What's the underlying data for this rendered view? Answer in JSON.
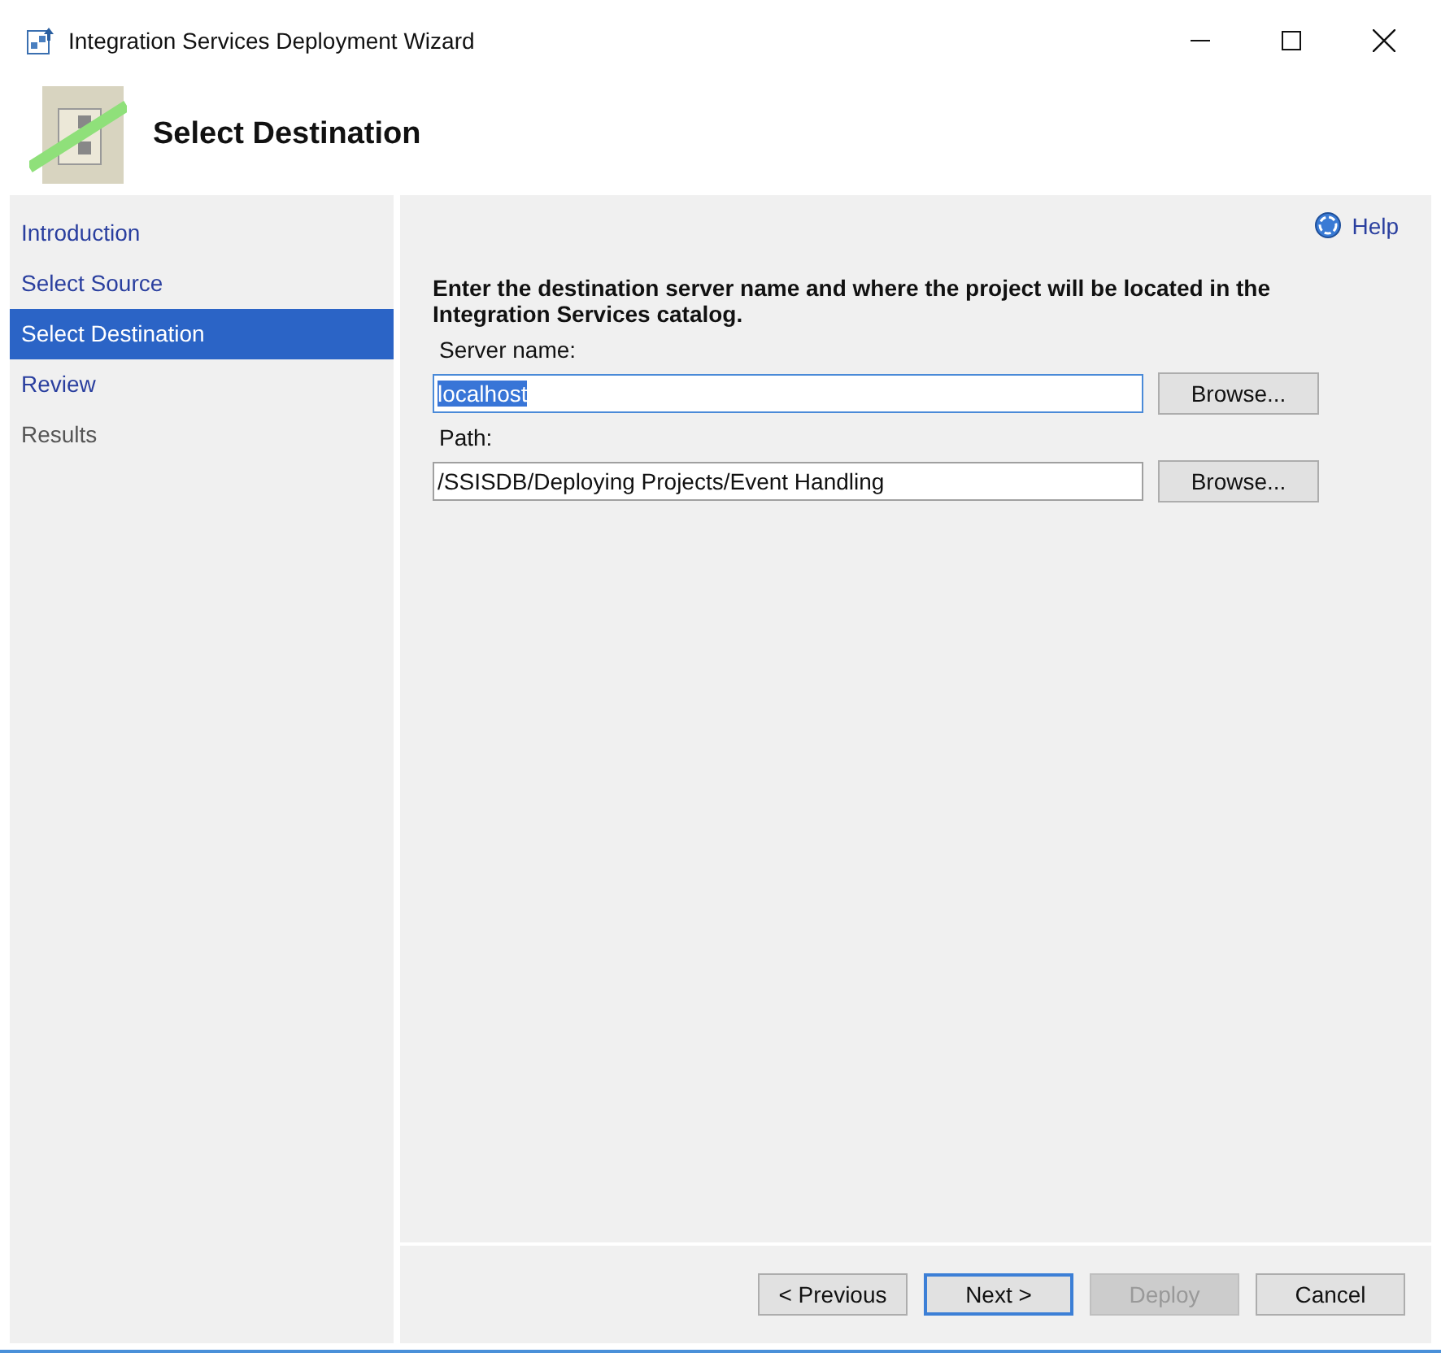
{
  "window": {
    "title": "Integration Services Deployment Wizard"
  },
  "header": {
    "title": "Select Destination"
  },
  "steps": [
    {
      "label": "Introduction",
      "selected": false,
      "enabled": true
    },
    {
      "label": "Select Source",
      "selected": false,
      "enabled": true
    },
    {
      "label": "Select Destination",
      "selected": true,
      "enabled": true
    },
    {
      "label": "Review",
      "selected": false,
      "enabled": true
    },
    {
      "label": "Results",
      "selected": false,
      "enabled": false
    }
  ],
  "help": {
    "label": "Help"
  },
  "instruction": "Enter the destination server name and where the project will be located in the Integration Services catalog.",
  "fields": [
    {
      "label": "Server name:",
      "value": "localhost",
      "highlighted": true,
      "focused": true,
      "button": "Browse..."
    },
    {
      "label": "Path:",
      "value": "/SSISDB/Deploying Projects/Event Handling",
      "highlighted": false,
      "focused": false,
      "button": "Browse..."
    }
  ],
  "buttons": [
    {
      "label": "< Previous",
      "default": false,
      "disabled": false
    },
    {
      "label": "Next >",
      "default": true,
      "disabled": false
    },
    {
      "label": "Deploy",
      "default": false,
      "disabled": true
    },
    {
      "label": "Cancel",
      "default": false,
      "disabled": false
    }
  ]
}
